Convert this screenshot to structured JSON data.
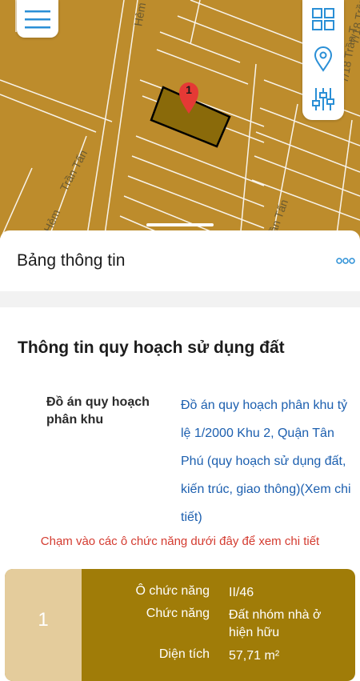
{
  "map": {
    "streets": {
      "hem_top": "Hẻm",
      "tran_tan_left": "Trần Tấn",
      "hem_bottom": "Hẻm",
      "tran_tan_right_top": "7/18 Trần T",
      "tran_tan_bottom": "Trần Tấn",
      "tran_tan_far_right": "7/18 Trần Tấ"
    },
    "marker_label": "1",
    "colors": {
      "land": "#bd8c2c",
      "lines": "#ffffff",
      "selected_outline": "#000000",
      "marker": "#e53935"
    }
  },
  "toolbar": {
    "menu_icon": "hamburger-menu-icon",
    "grid_icon": "grid-layers-icon",
    "location_icon": "location-pin-icon",
    "filter_icon": "sliders-settings-icon"
  },
  "panel": {
    "title": "Bảng thông tin",
    "section_title": "Thông tin quy hoạch sử dụng đất",
    "plan_label": "Đồ án quy hoạch phân khu",
    "plan_value": "Đồ án quy hoạch phân khu tỷ lệ 1/2000 Khu 2, Quận Tân Phú (quy hoạch sử dụng đất, kiến trúc, giao thông)(Xem chi tiết)",
    "hint": "Chạm vào các ô chức năng dưới đây để xem chi tiết"
  },
  "function_card": {
    "number": "1",
    "rows": [
      {
        "label": "Ô chức năng",
        "value": "II/46"
      },
      {
        "label": "Chức năng",
        "value": "Đất nhóm nhà ở hiện hữu"
      },
      {
        "label": "Diện tích",
        "value": "57,71 m²"
      }
    ],
    "colors": {
      "main": "#a07c08",
      "side": "#e4cc9c"
    }
  }
}
